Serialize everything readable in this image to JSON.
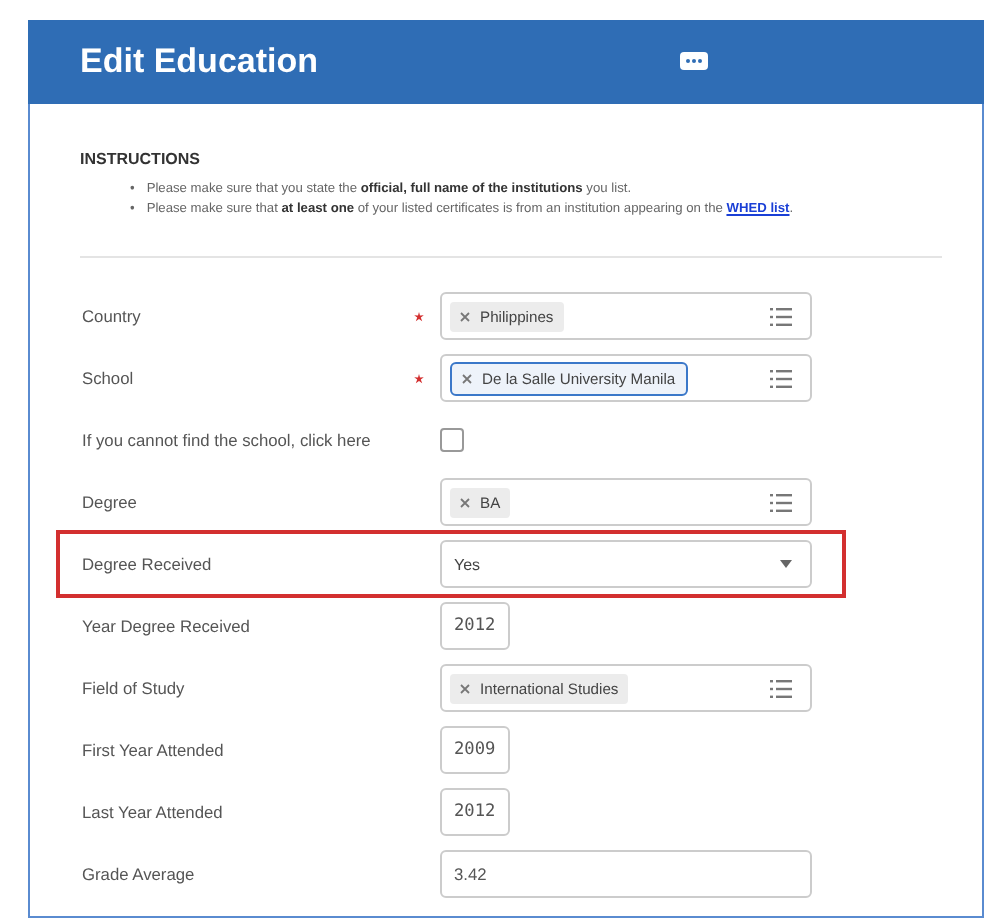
{
  "dialog": {
    "title": "Edit Education"
  },
  "instructions": {
    "heading": "INSTRUCTIONS",
    "items": [
      {
        "bullet": "•",
        "text": "Please make sure that you state the **official, full name of the institutions** you list."
      },
      {
        "bullet": "•",
        "text": "Please make sure that **at least one** of your listed certificates is from an institution appearing on the ",
        "link": "WHED list",
        "after": "."
      }
    ]
  },
  "fields": [
    {
      "label": "Country",
      "kind": "multiselect",
      "required": true,
      "chips": [
        "Philippines"
      ]
    },
    {
      "label": "School",
      "kind": "multiselect",
      "required": true,
      "focused": true,
      "chips": [
        "De la Salle University Manila"
      ]
    },
    {
      "label": "If you cannot find the school, click here",
      "kind": "checkbox",
      "checked": false
    },
    {
      "label": "Degree",
      "kind": "multiselect",
      "chips": [
        "BA"
      ]
    },
    {
      "label": "Degree Received",
      "kind": "select",
      "highlighted": true,
      "value": "Yes"
    },
    {
      "label": "Year Degree Received",
      "kind": "year",
      "value": "2012"
    },
    {
      "label": "Field of Study",
      "kind": "multiselect",
      "chips": [
        "International Studies"
      ]
    },
    {
      "label": "First Year Attended",
      "kind": "year",
      "value": "2009"
    },
    {
      "label": "Last Year Attended",
      "kind": "year",
      "value": "2012"
    },
    {
      "label": "Grade Average",
      "kind": "text",
      "value": "3.42"
    }
  ]
}
